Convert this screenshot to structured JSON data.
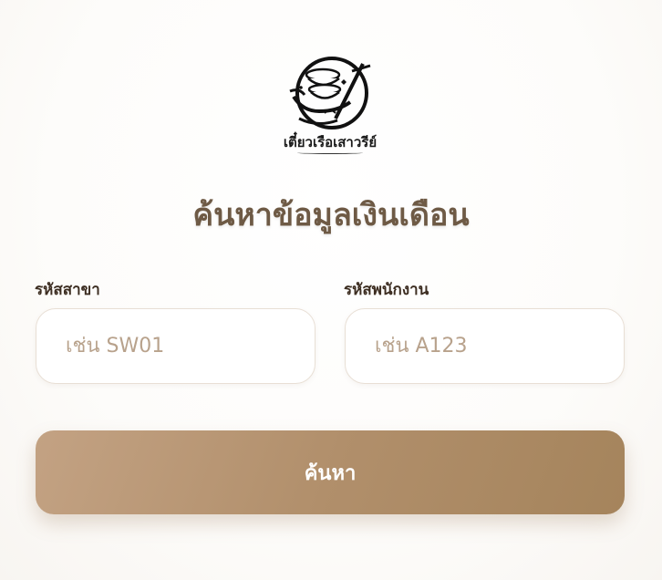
{
  "logo": {
    "text": "เตี๋ยวเรือเสาวรีย์",
    "icon": "noodle-bowl-logo-icon"
  },
  "page_title": "ค้นหาข้อมูลเงินเดือน",
  "form": {
    "branch_code": {
      "label": "รหัสสาขา",
      "placeholder": "เช่น SW01",
      "value": ""
    },
    "employee_code": {
      "label": "รหัสพนักงาน",
      "placeholder": "เช่น A123",
      "value": ""
    },
    "search_button_label": "ค้นหา"
  },
  "colors": {
    "title": "#6e5a45",
    "button_start": "#c3a283",
    "button_end": "#a5845c",
    "placeholder": "#b8a28c"
  }
}
